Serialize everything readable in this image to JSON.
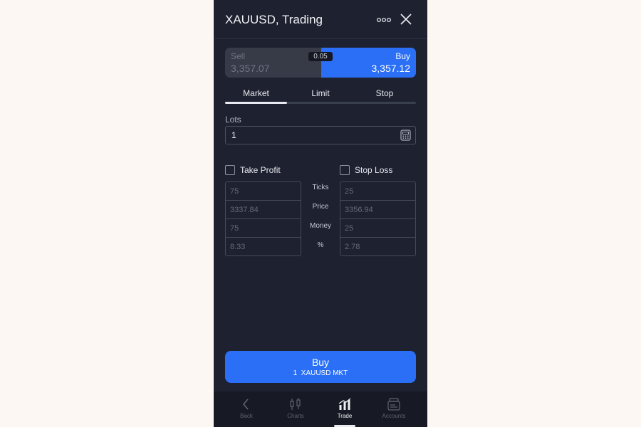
{
  "header": {
    "title": "XAUUSD, Trading"
  },
  "prices": {
    "sell_label": "Sell",
    "sell_price": "3,357.07",
    "buy_label": "Buy",
    "buy_price": "3,357.12",
    "spread": "0.05"
  },
  "order_tabs": [
    {
      "label": "Market",
      "active": true
    },
    {
      "label": "Limit",
      "active": false
    },
    {
      "label": "Stop",
      "active": false
    }
  ],
  "lots": {
    "label": "Lots",
    "value": "1"
  },
  "take_profit": {
    "label": "Take Profit",
    "ticks": "75",
    "price": "3337.84",
    "money": "75",
    "percent": "8.33"
  },
  "stop_loss": {
    "label": "Stop Loss",
    "ticks": "25",
    "price": "3356.94",
    "money": "25",
    "percent": "2.78"
  },
  "field_labels": {
    "ticks": "Ticks",
    "price": "Price",
    "money": "Money",
    "percent": "%"
  },
  "buy_button": {
    "title": "Buy",
    "subtitle": "1  XAUUSD MKT"
  },
  "nav": [
    {
      "label": "Back",
      "icon": "chevron-left-icon"
    },
    {
      "label": "Charts",
      "icon": "candlestick-icon"
    },
    {
      "label": "Trade",
      "icon": "bar-chart-icon"
    },
    {
      "label": "Accounts",
      "icon": "wallet-icon"
    }
  ],
  "colors": {
    "accent": "#2a6ff5",
    "background": "#1e2230",
    "page": "#fcf7f3"
  }
}
